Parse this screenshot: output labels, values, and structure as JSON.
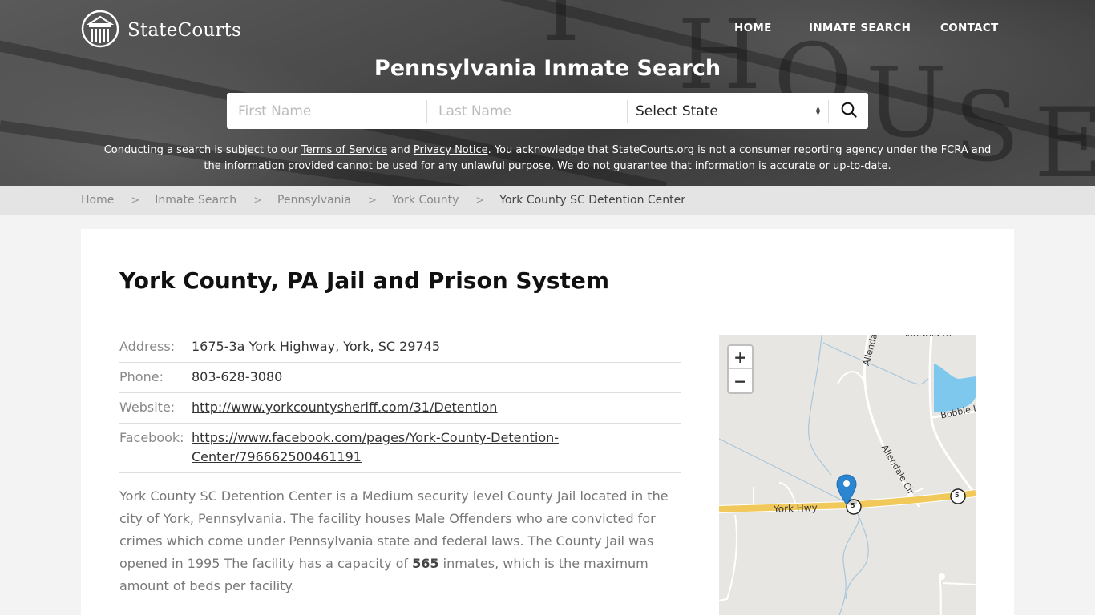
{
  "brand": {
    "name": "StateCourts",
    "logo_icon": "courthouse-icon"
  },
  "nav": {
    "items": [
      {
        "label": "HOME"
      },
      {
        "label": "INMATE SEARCH"
      },
      {
        "label": "CONTACT"
      }
    ]
  },
  "hero": {
    "title": "Pennsylvania Inmate Search",
    "search": {
      "first_name_placeholder": "First Name",
      "last_name_placeholder": "Last Name",
      "state_selected": "Select State",
      "search_icon": "search-icon"
    },
    "disclaimer": {
      "part1": "Conducting a search is subject to our ",
      "terms_link": "Terms of Service",
      "part2": " and ",
      "privacy_link": "Privacy Notice",
      "part3": ". You acknowledge that StateCourts.org is not a consumer reporting agency under the FCRA and the information provided cannot be used for any unlawful purpose. We do not guarantee that information is accurate or up-to-date."
    }
  },
  "breadcrumb": {
    "items": [
      {
        "label": "Home"
      },
      {
        "label": "Inmate Search"
      },
      {
        "label": "Pennsylvania"
      },
      {
        "label": "York County"
      }
    ],
    "current": "York County SC Detention Center"
  },
  "main": {
    "title": "York County, PA Jail and Prison System",
    "info": {
      "address_label": "Address:",
      "address": "1675-3a York Highway, York, SC 29745",
      "phone_label": "Phone:",
      "phone": "803-628-3080",
      "website_label": "Website:",
      "website": "http://www.yorkcountysheriff.com/31/Detention",
      "facebook_label": "Facebook:",
      "facebook_line1": "https://www.facebook.com/pages/York-County-Detention-",
      "facebook_line2": "Center/796662500461191"
    },
    "description": {
      "before": "York County SC Detention Center is a Medium security level County Jail located in the city of York, Pennsylvania. The facility houses Male Offenders who are convicted for crimes which come under Pennsylvania state and federal laws. The County Jail was opened in 1995 The facility has a capacity of ",
      "capacity": "565",
      "after": " inmates, which is the maximum amount of beds per facility."
    }
  },
  "map": {
    "zoom_in": "+",
    "zoom_out": "−",
    "labels": {
      "york_hwy": "York Hwy",
      "allendale_top": "Allenda",
      "allendale_cir": "Allendale Cir",
      "bobbie": "Bobbie I",
      "top_road": "latewild Dr",
      "route_shield": "5"
    },
    "colors": {
      "water": "#7ec8ee",
      "highway": "#f0c95a",
      "marker": "#2b85d0",
      "land": "#e8e6e2"
    }
  }
}
